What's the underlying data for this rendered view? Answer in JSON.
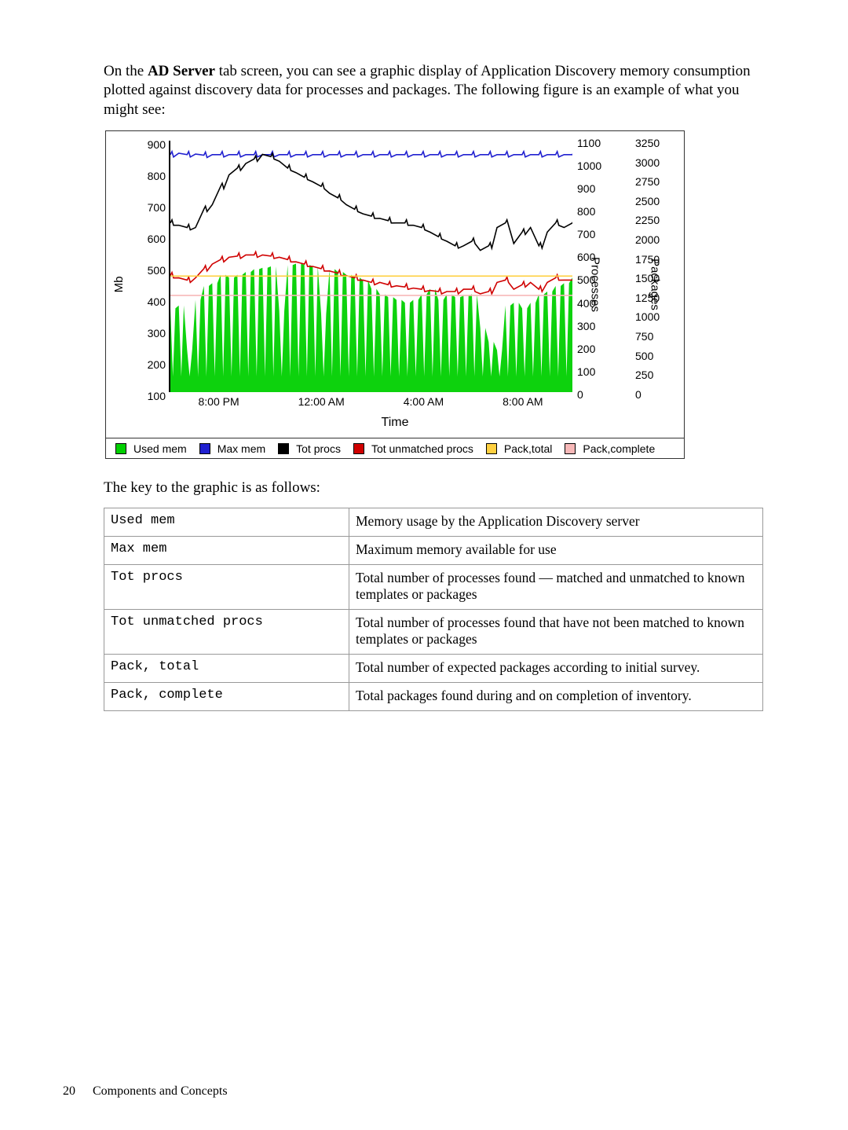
{
  "intro": {
    "prefix": "On the ",
    "bold": "AD Server",
    "suffix": " tab screen, you can see a graphic display of Application Discovery memory consumption plotted against discovery data for processes and packages. The following figure is an example of what you might see:"
  },
  "chart_data": {
    "type": "line",
    "xlabel": "Time",
    "x_ticks": [
      "8:00 PM",
      "12:00 AM",
      "4:00 AM",
      "8:00 AM"
    ],
    "y_left": {
      "label": "Mb",
      "ticks": [
        100,
        200,
        300,
        400,
        500,
        600,
        700,
        800,
        900
      ],
      "range": [
        50,
        950
      ]
    },
    "y_right1": {
      "label": "Processes",
      "ticks": [
        0,
        100,
        200,
        300,
        400,
        500,
        600,
        700,
        800,
        900,
        1000,
        1100
      ],
      "range": [
        0,
        1100
      ]
    },
    "y_right2": {
      "label": "Packages",
      "ticks": [
        0,
        250,
        500,
        750,
        1000,
        1250,
        1500,
        1750,
        2000,
        2250,
        2500,
        2750,
        3000,
        3250
      ],
      "range": [
        0,
        3250
      ]
    },
    "series": [
      {
        "name": "Used mem",
        "color": "#00d000",
        "axis": "left",
        "values": [
          350,
          360,
          200,
          380,
          430,
          440,
          470,
          460,
          470,
          480,
          490,
          495,
          500,
          340,
          505,
          510,
          505,
          500,
          330,
          490,
          480,
          470,
          460,
          450,
          420,
          400,
          390,
          380,
          370,
          380,
          400,
          420,
          380,
          400,
          390,
          395,
          400,
          280,
          230,
          200,
          360,
          370,
          350,
          370,
          400,
          410,
          430,
          440,
          460
        ]
      },
      {
        "name": "Max mem",
        "color": "#2020d0",
        "axis": "left",
        "values": [
          900,
          905,
          900,
          902,
          898,
          900,
          900,
          900,
          900,
          900,
          900,
          900,
          900,
          900,
          900,
          900,
          900,
          900,
          900,
          900,
          900,
          900,
          900,
          900,
          900,
          900,
          900,
          900,
          900,
          900,
          900,
          900,
          900,
          900,
          900,
          900,
          900,
          900,
          900,
          900,
          900,
          900,
          900,
          900,
          900,
          900,
          900,
          900,
          900
        ]
      },
      {
        "name": "Tot procs",
        "color": "#000000",
        "axis": "right1",
        "values": [
          740,
          730,
          720,
          720,
          800,
          820,
          900,
          950,
          980,
          1000,
          1020,
          1040,
          1030,
          1010,
          980,
          960,
          940,
          920,
          900,
          870,
          850,
          820,
          800,
          780,
          770,
          760,
          750,
          740,
          740,
          730,
          720,
          700,
          680,
          660,
          640,
          640,
          660,
          620,
          640,
          720,
          740,
          650,
          700,
          720,
          640,
          700,
          740,
          720,
          740
        ]
      },
      {
        "name": "Tot unmatched procs",
        "color": "#d00000",
        "axis": "right1",
        "values": [
          510,
          500,
          490,
          500,
          540,
          560,
          580,
          590,
          595,
          600,
          600,
          600,
          595,
          590,
          580,
          570,
          560,
          550,
          540,
          530,
          520,
          510,
          500,
          490,
          480,
          480,
          470,
          465,
          460,
          455,
          450,
          445,
          440,
          440,
          440,
          450,
          450,
          430,
          440,
          480,
          490,
          450,
          470,
          480,
          450,
          480,
          500,
          490,
          490
        ]
      },
      {
        "name": "Pack,total",
        "color": "#ffd040",
        "axis": "right2",
        "values": [
          1500,
          1500,
          1500,
          1500,
          1500,
          1500,
          1500,
          1500,
          1500,
          1500,
          1500,
          1500,
          1500,
          1500,
          1500,
          1500,
          1500,
          1500,
          1500,
          1500,
          1500,
          1500,
          1500,
          1500,
          1500,
          1500,
          1500,
          1500,
          1500,
          1500,
          1500,
          1500,
          1500,
          1500,
          1500,
          1500,
          1500,
          1500,
          1500,
          1500,
          1500,
          1500,
          1500,
          1500,
          1500,
          1500,
          1500,
          1500,
          1500
        ]
      },
      {
        "name": "Pack,complete",
        "color": "#f7b8b8",
        "axis": "right2",
        "values": [
          1250,
          1250,
          1250,
          1250,
          1250,
          1250,
          1250,
          1250,
          1250,
          1250,
          1250,
          1250,
          1250,
          1250,
          1250,
          1250,
          1250,
          1250,
          1250,
          1250,
          1250,
          1250,
          1250,
          1250,
          1250,
          1250,
          1250,
          1250,
          1250,
          1250,
          1250,
          1250,
          1250,
          1250,
          1250,
          1250,
          1250,
          1250,
          1250,
          1250,
          1250,
          1250,
          1250,
          1250,
          1250,
          1250,
          1250,
          1250,
          1250
        ]
      }
    ],
    "legend": [
      {
        "label": "Used mem",
        "color": "#00d000"
      },
      {
        "label": "Max mem",
        "color": "#2020d0"
      },
      {
        "label": "Tot procs",
        "color": "#000000"
      },
      {
        "label": "Tot unmatched procs",
        "color": "#d00000"
      },
      {
        "label": "Pack,total",
        "color": "#ffd040"
      },
      {
        "label": "Pack,complete",
        "color": "#f7b8b8"
      }
    ]
  },
  "key_intro": "The key to the graphic is as follows:",
  "key_table": [
    {
      "term": "Used mem",
      "desc": "Memory usage by the Application Discovery server"
    },
    {
      "term": "Max mem",
      "desc": "Maximum memory available for use"
    },
    {
      "term": "Tot procs",
      "desc": "Total number of processes found — matched and unmatched to known templates or packages"
    },
    {
      "term": "Tot unmatched procs",
      "desc": "Total number of processes found that have not been matched to known templates or packages"
    },
    {
      "term": "Pack, total",
      "desc": "Total number of expected packages according to initial survey."
    },
    {
      "term": "Pack, complete",
      "desc": "Total packages found during and on completion of inventory."
    }
  ],
  "footer": {
    "page": "20",
    "section": "Components and Concepts"
  }
}
